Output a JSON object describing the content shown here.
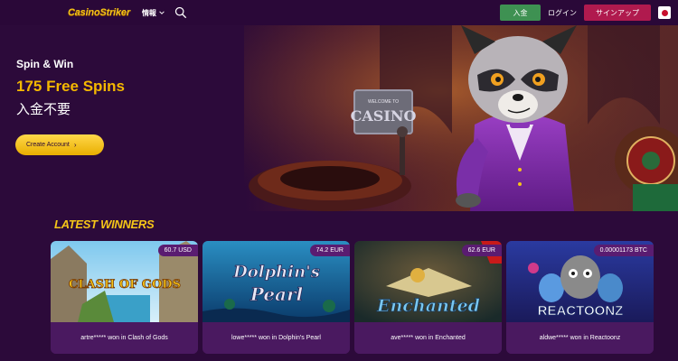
{
  "header": {
    "logo": "CasinoStriker",
    "news_label": "情報",
    "deposit_label": "入金",
    "login_label": "ログイン",
    "signup_label": "サインアップ"
  },
  "hero": {
    "subtitle": "Spin & Win",
    "title": "175 Free Spins",
    "subtitle_jp": "入金不要",
    "cta_label": "Create Account",
    "sign_line1": "WELCOME TO",
    "sign_line2": "CASINO"
  },
  "winners": {
    "title": "LATEST WINNERS",
    "cards": [
      {
        "amount": "60.7 USD",
        "game_title": "CLASH OF GODS",
        "caption": "artre***** won in Clash of Gods"
      },
      {
        "amount": "74.2 EUR",
        "game_title_1": "Dolphin's",
        "game_title_2": "Pearl",
        "caption": "lowe***** won in Dolphin's Pearl"
      },
      {
        "amount": "62.6 EUR",
        "game_title": "Enchanted",
        "caption": "ave***** won in Enchanted"
      },
      {
        "amount": "0.00001173 BTC",
        "game_title": "REACTOONZ",
        "caption": "aldwe***** won in Reactoonz"
      }
    ]
  },
  "colors": {
    "background": "#2c0a3a",
    "accent_yellow": "#f5c518",
    "deposit_green": "#3e9152",
    "signup_pink": "#b01a4e",
    "card_bg": "#4a1960"
  },
  "icons": {
    "news_chevron": "chevron-down-icon",
    "search": "search-icon",
    "flag": "japan-flag-icon",
    "cta_chevron": "chevron-right-icon"
  }
}
